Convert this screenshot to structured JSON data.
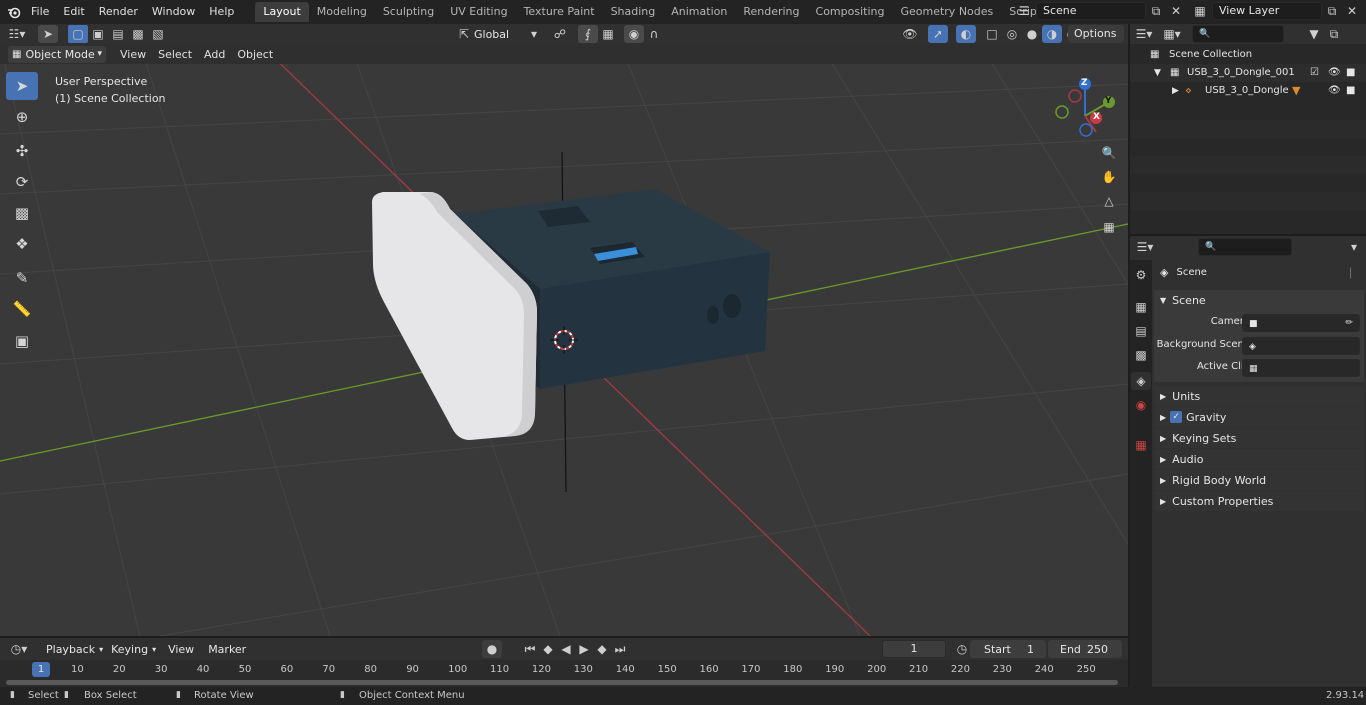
{
  "topbar": {
    "menus": [
      "File",
      "Edit",
      "Render",
      "Window",
      "Help"
    ],
    "workspaces": [
      "Layout",
      "Modeling",
      "Sculpting",
      "UV Editing",
      "Texture Paint",
      "Shading",
      "Animation",
      "Rendering",
      "Compositing",
      "Geometry Nodes",
      "Scripting"
    ],
    "active_workspace": "Layout",
    "add_tab": "+",
    "scene_name": "Scene",
    "view_layer_name": "View Layer"
  },
  "viewport_header": {
    "mode": "Object Mode",
    "menus": [
      "View",
      "Select",
      "Add",
      "Object"
    ],
    "transform_orientation": "Global",
    "options_label": "Options"
  },
  "viewport": {
    "perspective_label": "User Perspective",
    "collection_label": "(1) Scene Collection",
    "gizmo_axes": [
      "X",
      "Y",
      "Z"
    ]
  },
  "outliner": {
    "root": "Scene Collection",
    "collection": "USB_3_0_Dongle_001",
    "object": "USB_3_0_Dongle"
  },
  "properties": {
    "context_title": "Scene",
    "panel_title": "Scene",
    "fields": [
      {
        "label": "Camera",
        "value": ""
      },
      {
        "label": "Background Scene",
        "value": ""
      },
      {
        "label": "Active Clip",
        "value": ""
      }
    ],
    "subpanels": [
      "Units",
      "Gravity",
      "Keying Sets",
      "Audio",
      "Rigid Body World",
      "Custom Properties"
    ],
    "gravity_checked": true
  },
  "timeline": {
    "menus": [
      "Playback",
      "Keying",
      "View",
      "Marker"
    ],
    "current_frame": "1",
    "start_label": "Start",
    "start_value": "1",
    "end_label": "End",
    "end_value": "250",
    "ruler_active": "1",
    "ruler_ticks": [
      "10",
      "20",
      "30",
      "40",
      "50",
      "60",
      "70",
      "80",
      "90",
      "100",
      "110",
      "120",
      "130",
      "140",
      "150",
      "160",
      "170",
      "180",
      "190",
      "200",
      "210",
      "220",
      "230",
      "240",
      "250"
    ]
  },
  "statusbar": {
    "select": "Select",
    "box_select": "Box Select",
    "rotate_view": "Rotate View",
    "context_menu": "Object Context Menu",
    "version": "2.93.14"
  },
  "colors": {
    "accent": "#4772b3",
    "x_axis": "#a33a42",
    "y_axis": "#6b9a2c",
    "z_axis": "#2f6fd1",
    "orange": "#e08a2b"
  }
}
